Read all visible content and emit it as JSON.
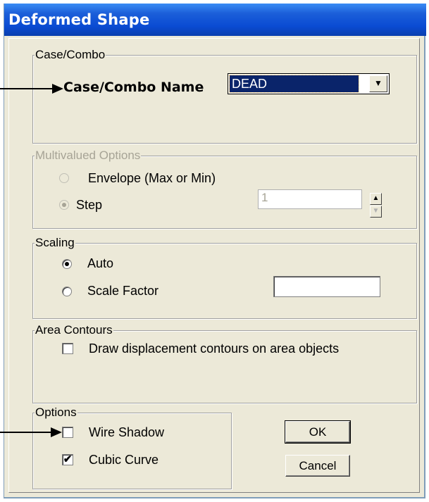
{
  "window": {
    "title": "Deformed Shape"
  },
  "case_combo": {
    "group_label": "Case/Combo",
    "name_label": "Case/Combo Name",
    "selected": "DEAD",
    "arrow_glyph": "▼"
  },
  "multivalued": {
    "group_label": "Multivalued Options",
    "envelope_label": "Envelope (Max or Min)",
    "step_label": "Step",
    "step_value": "1",
    "selected": "Step",
    "enabled": false
  },
  "scaling": {
    "group_label": "Scaling",
    "auto_label": "Auto",
    "scale_factor_label": "Scale Factor",
    "scale_factor_value": "",
    "selected": "Auto"
  },
  "area_contours": {
    "group_label": "Area Contours",
    "draw_label": "Draw displacement contours on area objects",
    "draw_checked": false
  },
  "options": {
    "group_label": "Options",
    "wire_shadow_label": "Wire Shadow",
    "wire_shadow_checked": false,
    "cubic_curve_label": "Cubic Curve",
    "cubic_curve_checked": true
  },
  "buttons": {
    "ok": "OK",
    "cancel": "Cancel"
  },
  "icons": {
    "spin_up": "▲",
    "spin_down": "▼",
    "check_mark": "✔"
  },
  "colors": {
    "title_bar": "#0a4bd3",
    "selection": "#0a246a",
    "dialog_bg": "#ece9d8"
  }
}
